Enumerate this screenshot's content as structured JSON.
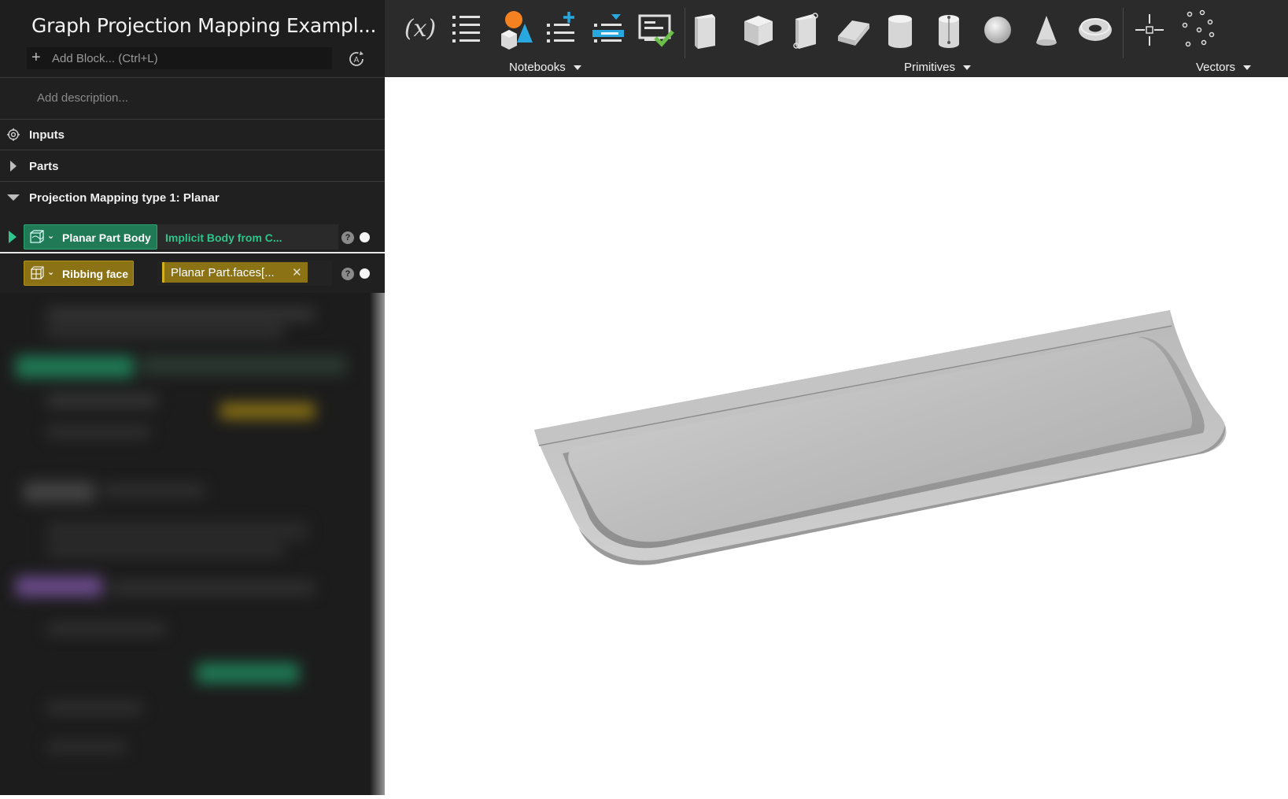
{
  "document": {
    "title": "Graph Projection Mapping Exampl...",
    "add_block_placeholder": "Add Block... (Ctrl+L)",
    "description_placeholder": "Add description..."
  },
  "sections": {
    "inputs": "Inputs",
    "parts": "Parts",
    "projection": "Projection Mapping type 1: Planar"
  },
  "blocks": {
    "body": {
      "label": "Planar Part Body",
      "value": "Implicit Body from C...",
      "color": "#1f7a55"
    },
    "face": {
      "label": "Ribbing face",
      "value": "Planar Part.faces[...",
      "color": "#8b7214"
    }
  },
  "toolbar": {
    "notebooks_label": "Notebooks",
    "primitives_label": "Primitives",
    "vectors_label": "Vectors",
    "variable_symbol": "(x)",
    "help_symbol": "?",
    "clear_symbol": "✕",
    "buttons": [
      "variable-icon",
      "list-icon",
      "shapes-icon",
      "list-add-icon",
      "list-edit-icon",
      "notebook-check-icon",
      "box-tall-icon",
      "cube-icon",
      "box-edge-icon",
      "wedge-icon",
      "cylinder-icon",
      "cylinder-axis-icon",
      "sphere-icon",
      "cone-icon",
      "torus-icon",
      "point-icon",
      "point-cloud-icon"
    ]
  },
  "colors": {
    "panel_bg": "#202020",
    "toolbar_bg": "#2b2b2b",
    "green_accent": "#2ec48c",
    "gold_accent": "#b39214",
    "blue_accent": "#29a8e0",
    "orange_accent": "#f58220"
  }
}
